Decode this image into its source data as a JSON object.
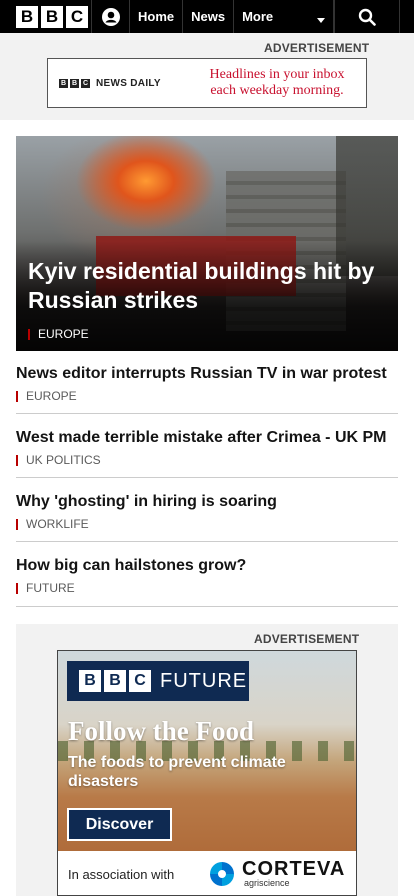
{
  "nav": {
    "logo_letters": [
      "B",
      "B",
      "C"
    ],
    "links": [
      "Home",
      "News",
      "More"
    ],
    "account_icon": "user-icon",
    "search_icon": "search-icon",
    "more_icon": "caret-down-icon"
  },
  "top_ad": {
    "label": "ADVERTISEMENT",
    "brand_letters": [
      "B",
      "B",
      "C"
    ],
    "brand_text": "NEWS DAILY",
    "headline_line1": "Headlines in your inbox",
    "headline_line2": "each weekday morning.",
    "headline_color": "#c8102e"
  },
  "hero": {
    "headline": "Kyiv residential buildings hit by Russian strikes",
    "tag": "EUROPE",
    "tag_color": "#b80000"
  },
  "stories": [
    {
      "headline": "News editor interrupts Russian TV in war protest",
      "tag": "EUROPE"
    },
    {
      "headline": "West made terrible mistake after Crimea - UK PM",
      "tag": "UK POLITICS"
    },
    {
      "headline": "Why 'ghosting' in hiring is soaring",
      "tag": "WORKLIFE"
    },
    {
      "headline": "How big can hailstones grow?",
      "tag": "FUTURE"
    }
  ],
  "bottom_ad": {
    "label": "ADVERTISEMENT",
    "brand_letters": [
      "B",
      "B",
      "C"
    ],
    "brand_word": "FUTURE",
    "title": "Follow the Food",
    "subtitle": "The foods to prevent climate disasters",
    "cta": "Discover",
    "assoc": "In association with",
    "sponsor": "CORTEVA",
    "sponsor_sub": "agriscience",
    "brand_color": "#0f2a52"
  }
}
